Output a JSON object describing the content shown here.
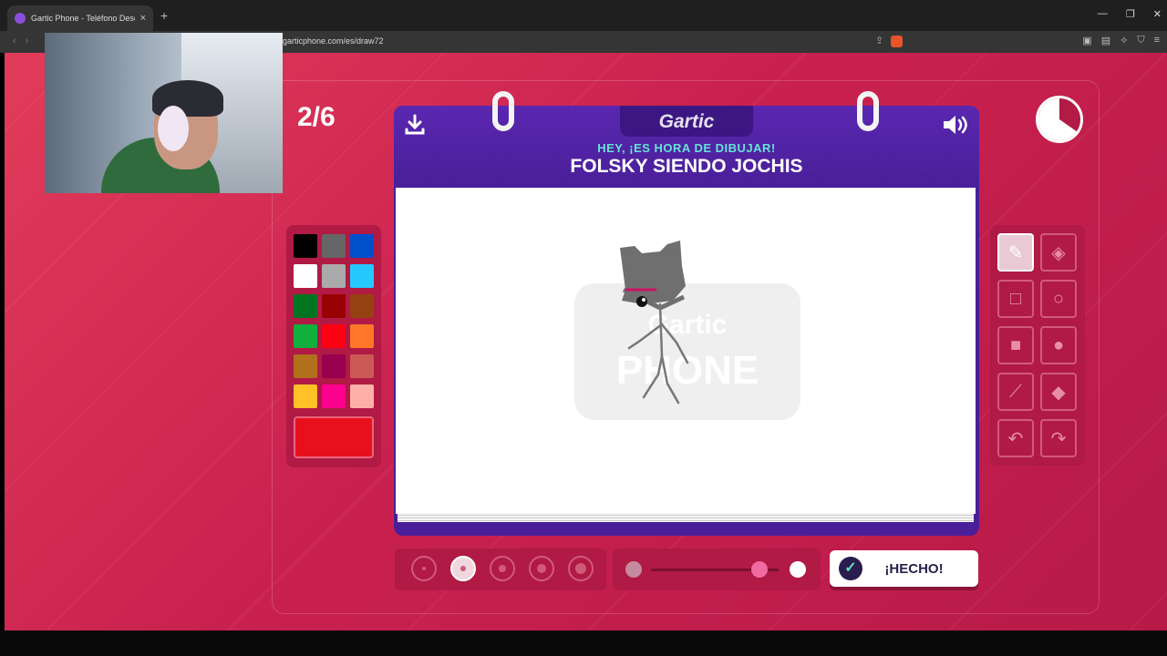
{
  "browser": {
    "tab_title": "Gartic Phone - Teléfono Descom",
    "url": "garticphone.com/es/draw72",
    "new_tab": "+",
    "tab_close": "×",
    "back": "‹",
    "forward": "›",
    "minimize": "—",
    "restore": "❐",
    "close": "✕"
  },
  "game": {
    "round": "2/6",
    "logo": "Gartic",
    "subtitle": "HEY, ¡ES HORA DE DIBUJAR!",
    "prompt": "FOLSKY SIENDO JOCHIS",
    "watermark": "Gartic PHONE",
    "done_label": "¡HECHO!",
    "selected_color": "#e8101c"
  },
  "palette": [
    "#000000",
    "#666666",
    "#0050cd",
    "#ffffff",
    "#aaaaaa",
    "#26c9ff",
    "#017420",
    "#990000",
    "#964112",
    "#11b03c",
    "#ff0013",
    "#ff7829",
    "#b0701c",
    "#99004e",
    "#cb5a57",
    "#ffc126",
    "#ff008f",
    "#feafa8"
  ],
  "tools": [
    {
      "name": "pencil-tool",
      "glyph": "✎"
    },
    {
      "name": "eraser-tool",
      "glyph": "◈"
    },
    {
      "name": "rectangle-outline-tool",
      "glyph": "□"
    },
    {
      "name": "ellipse-outline-tool",
      "glyph": "○"
    },
    {
      "name": "rectangle-filled-tool",
      "glyph": "■"
    },
    {
      "name": "ellipse-filled-tool",
      "glyph": "●"
    },
    {
      "name": "line-tool",
      "glyph": "⟋"
    },
    {
      "name": "fill-bucket-tool",
      "glyph": "◆"
    },
    {
      "name": "undo-tool",
      "glyph": "↶"
    },
    {
      "name": "redo-tool",
      "glyph": "↷"
    }
  ],
  "brush_sizes": [
    1,
    2,
    3,
    4,
    5
  ],
  "selected_brush_size": 2,
  "opacity_level": 0.85
}
